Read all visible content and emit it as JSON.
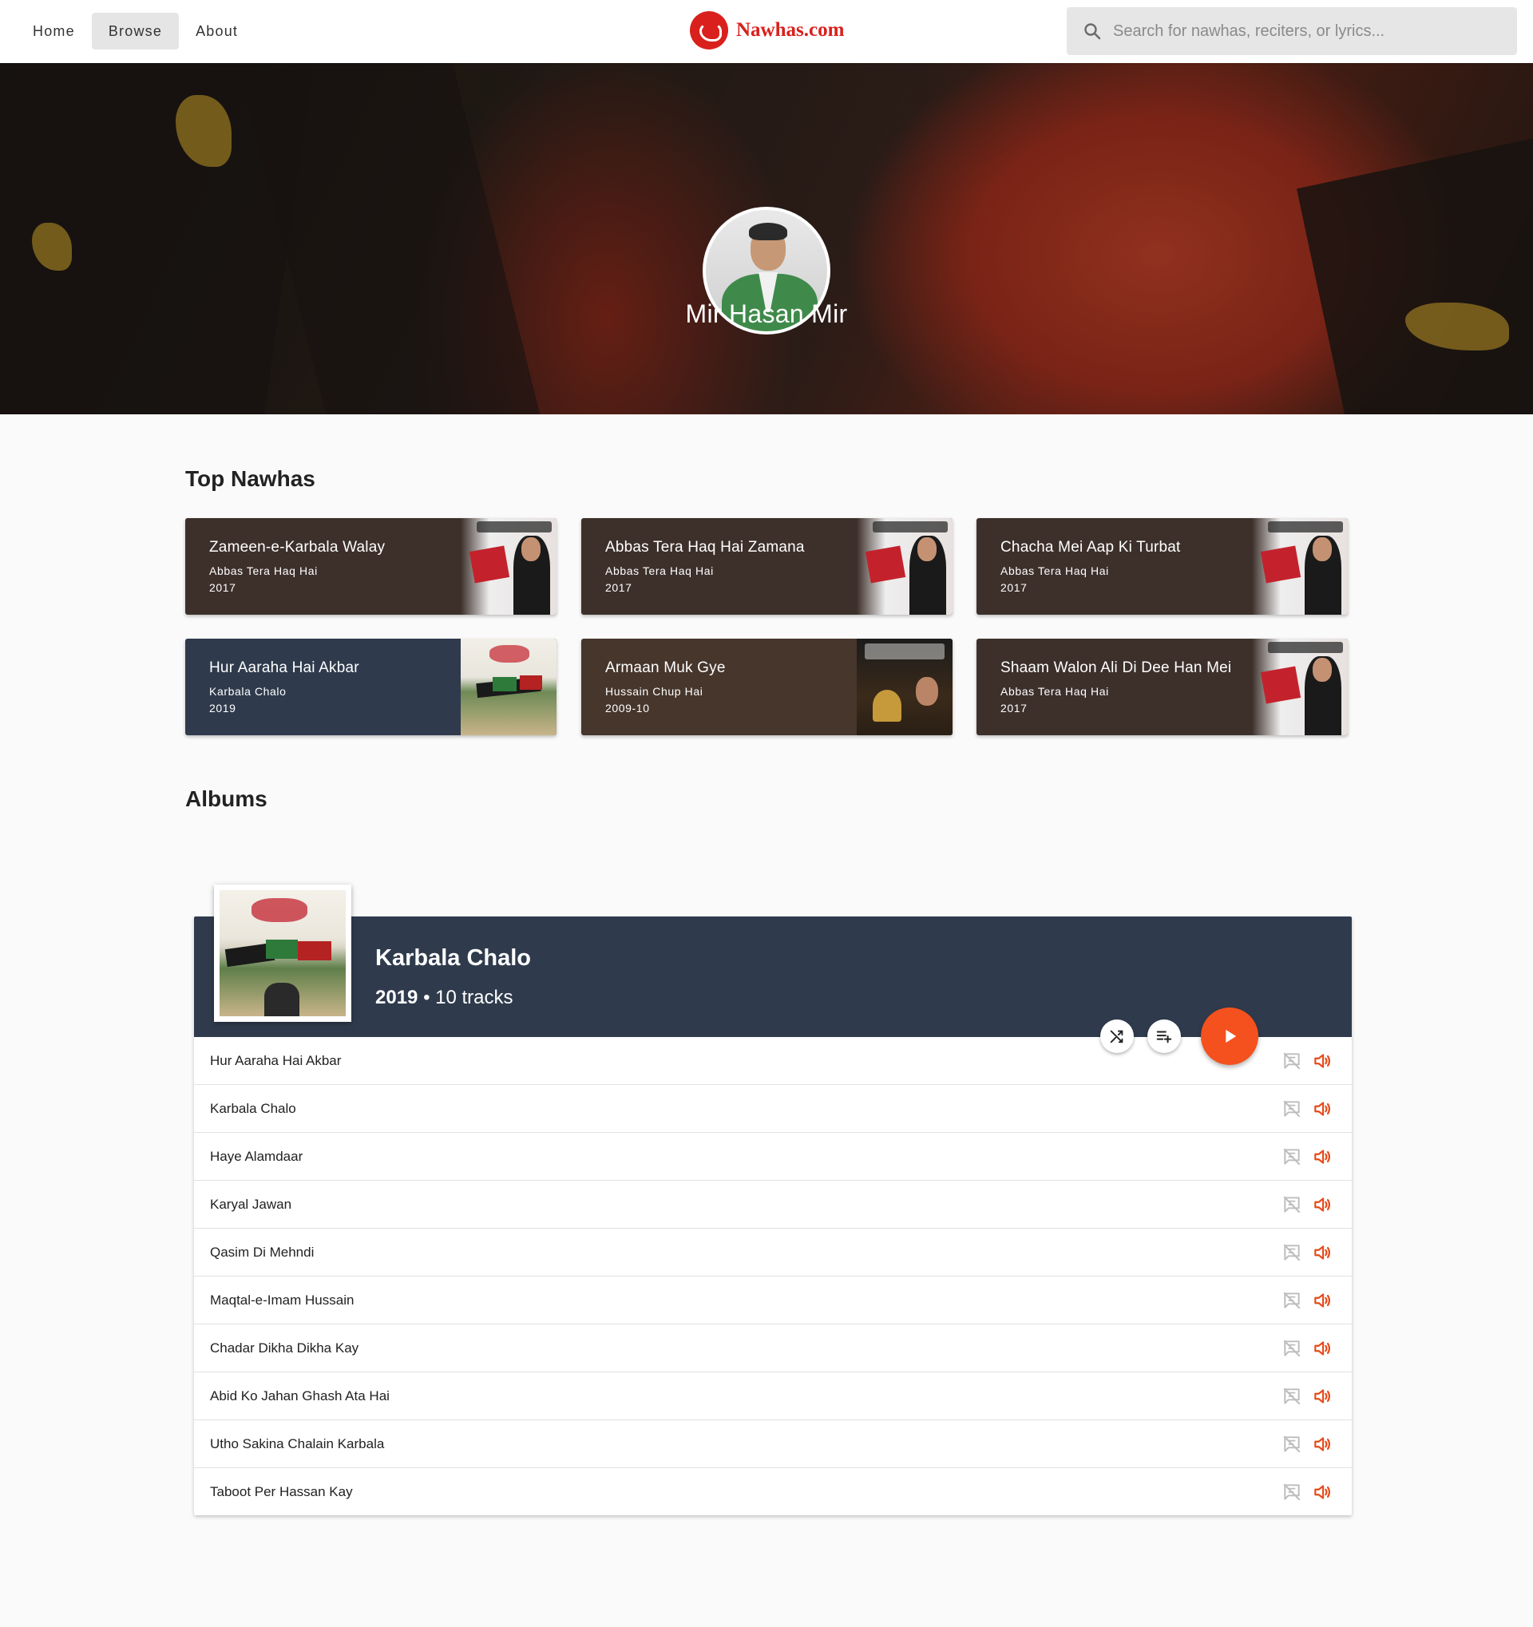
{
  "nav": {
    "items": [
      {
        "label": "Home",
        "active": false
      },
      {
        "label": "Browse",
        "active": true
      },
      {
        "label": "About",
        "active": false
      }
    ]
  },
  "logo": {
    "text": "Nawhas.com",
    "color": "#d9201c"
  },
  "search": {
    "placeholder": "Search for nawhas, reciters, or lyrics...",
    "value": ""
  },
  "reciter": {
    "name": "Mir Hasan Mir"
  },
  "top_nawhas": {
    "title": "Top Nawhas",
    "items": [
      {
        "title": "Zameen-e-Karbala Walay",
        "album": "Abbas Tera Haq Hai",
        "year": "2017",
        "color": "#3d302b"
      },
      {
        "title": "Abbas Tera Haq Hai Zamana",
        "album": "Abbas Tera Haq Hai",
        "year": "2017",
        "color": "#3d302b"
      },
      {
        "title": "Chacha Mei Aap Ki Turbat",
        "album": "Abbas Tera Haq Hai",
        "year": "2017",
        "color": "#3d302b"
      },
      {
        "title": "Hur Aaraha Hai Akbar",
        "album": "Karbala Chalo",
        "year": "2019",
        "color": "#2f3b4d"
      },
      {
        "title": "Armaan Muk Gye",
        "album": "Hussain Chup Hai",
        "year": "2009-10",
        "color": "#46362c"
      },
      {
        "title": "Shaam Walon Ali Di Dee Han Mei",
        "album": "Abbas Tera Haq Hai",
        "year": "2017",
        "color": "#3d302b"
      }
    ]
  },
  "albums": {
    "title": "Albums",
    "items": [
      {
        "title": "Karbala Chalo",
        "year": "2019",
        "separator": "•",
        "tracks_label": "10 tracks",
        "header_color": "#2f3b4d",
        "play_color": "#f4511e",
        "tracks": [
          "Hur Aaraha Hai Akbar",
          "Karbala Chalo",
          "Haye Alamdaar",
          "Karyal Jawan",
          "Qasim Di Mehndi",
          "Maqtal-e-Imam Hussain",
          "Chadar Dikha Dikha Kay",
          "Abid Ko Jahan Ghash Ata Hai",
          "Utho Sakina Chalain Karbala",
          "Taboot Per Hassan Kay"
        ]
      }
    ]
  },
  "icons": {
    "search": "search-icon",
    "shuffle": "shuffle-icon",
    "queue": "playlist-add-icon",
    "play": "play-icon",
    "lyrics": "no-lyrics-icon",
    "audio": "volume-icon"
  }
}
